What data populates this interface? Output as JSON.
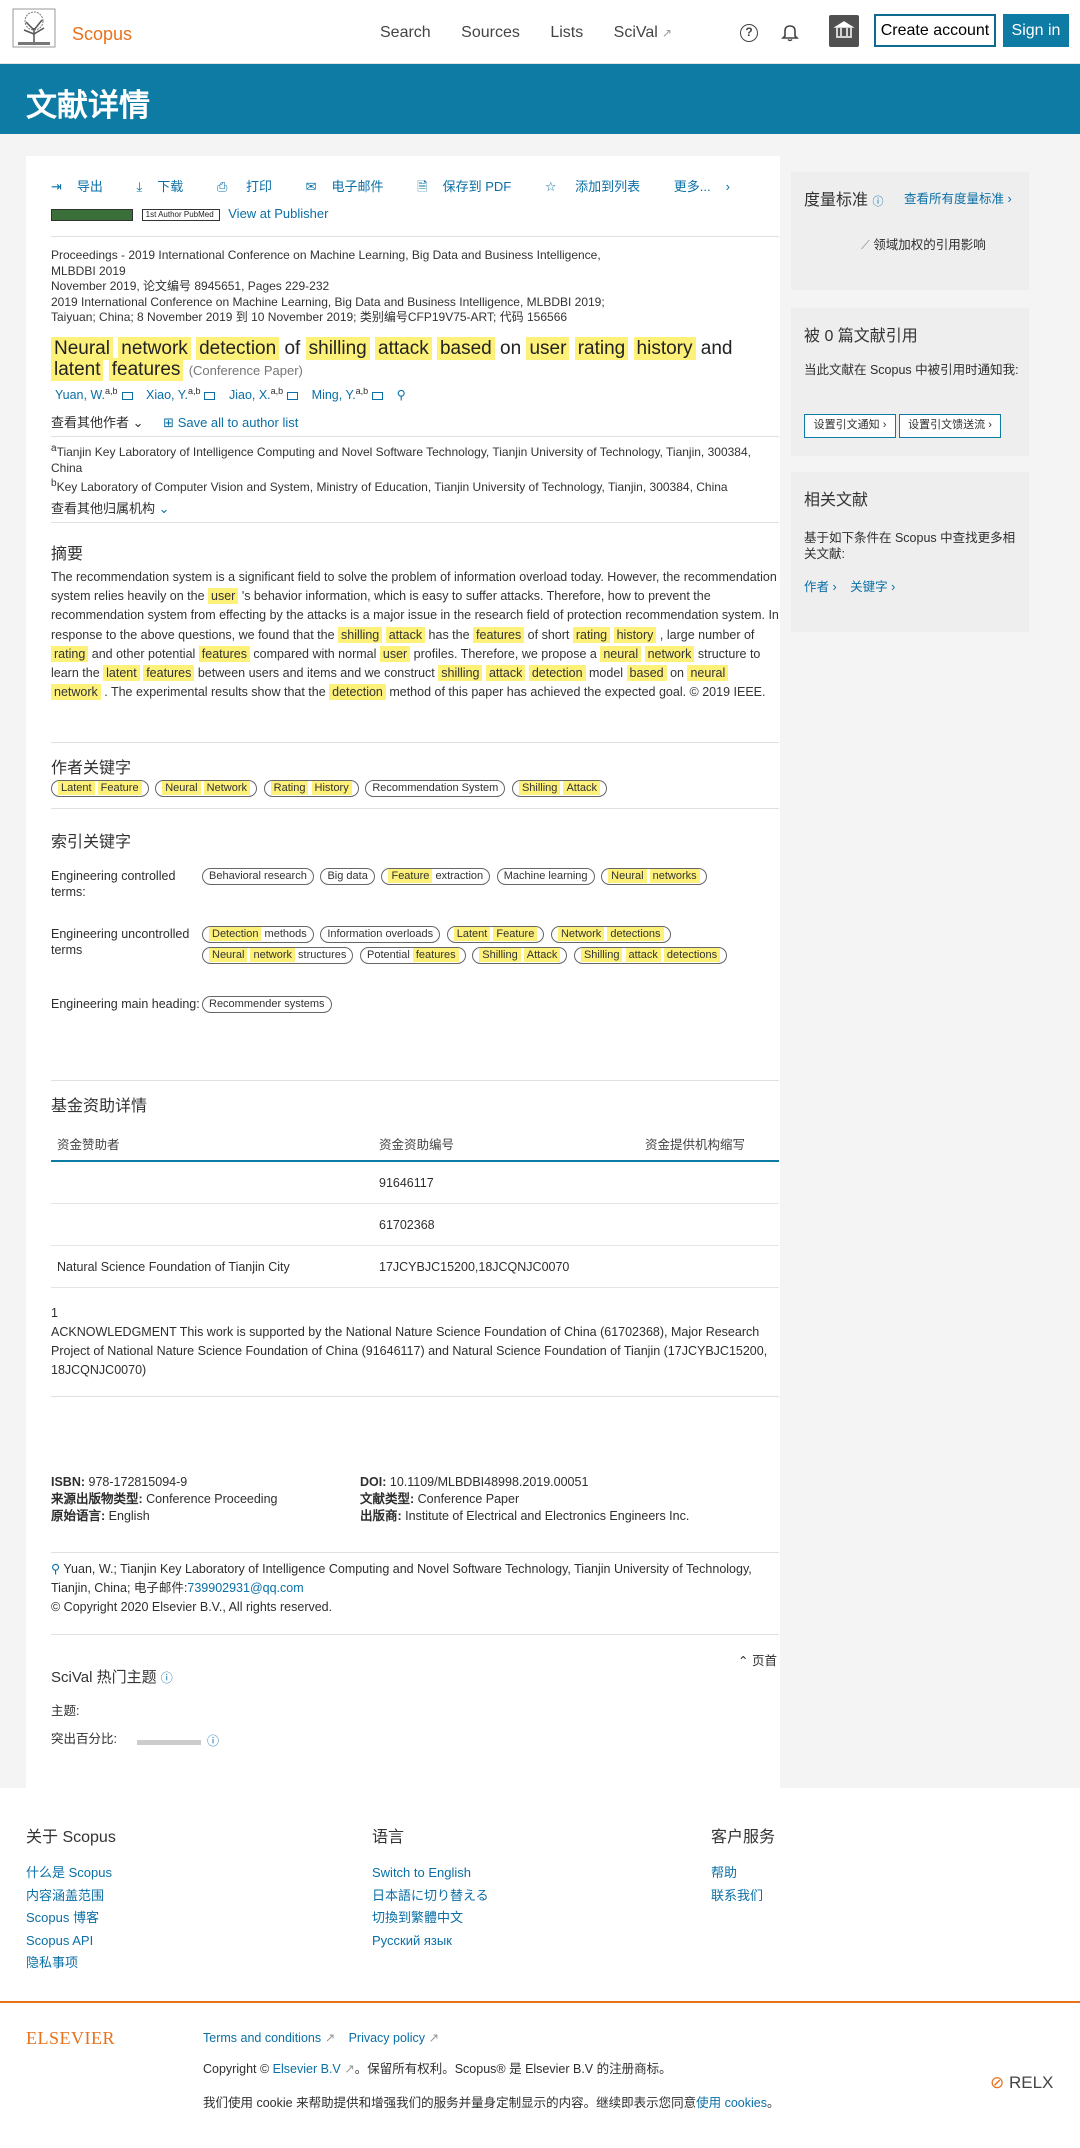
{
  "header": {
    "brand": "Scopus",
    "nav": [
      "Search",
      "Sources",
      "Lists",
      "SciVal"
    ],
    "nav_ext": "↗",
    "create_account": "Create account",
    "sign_in": "Sign in",
    "help": "?"
  },
  "title": "文献详情",
  "toolbar": [
    "导出",
    "下载",
    "打印",
    "电子邮件",
    "保存到 PDF",
    "添加到列表",
    "更多..."
  ],
  "badges": [
    "1st Author PubMed"
  ],
  "view_publisher": "View at Publisher",
  "source_lines": [
    "Proceedings - 2019 International Conference on Machine Learning, Big Data and Business Intelligence,",
    "MLBDBI 2019",
    "November 2019, 论文编号 8945651, Pages 229-232",
    "2019 International Conference on Machine Learning, Big Data and Business Intelligence, MLBDBI 2019;",
    "Taiyuan; China; 8 November 2019 到 10 November 2019; 类别编号CFP19V75-ART; 代码 156566"
  ],
  "doc_title": {
    "line1": [
      "Neural",
      "network",
      "detection",
      "of",
      "shilling",
      "attack",
      "based",
      "on",
      "user",
      "rating",
      "history",
      "and"
    ],
    "line2": [
      "latent",
      "features"
    ],
    "type": "(Conference Paper)"
  },
  "authors": [
    {
      "name": "Yuan, W.",
      "sup": "a,b"
    },
    {
      "name": "Xiao, Y.",
      "sup": "a,b"
    },
    {
      "name": "Jiao, X.",
      "sup": "a,b"
    },
    {
      "name": "Ming, Y.",
      "sup": "a,b"
    }
  ],
  "more_authors": "查看其他作者",
  "save_authors": "Save all to author list",
  "affiliations": [
    {
      "sup": "a",
      "text": "Tianjin Key Laboratory of Intelligence Computing and Novel Software Technology, Tianjin University of Technology, Tianjin, 300384, China"
    },
    {
      "sup": "b",
      "text": "Key Laboratory of Computer Vision and System, Ministry of Education, Tianjin University of Technology, Tianjin, 300384, China"
    }
  ],
  "more_affil": "查看其他归属机构",
  "abstract_heading": "摘要",
  "abstract": "The recommendation system is a significant field to solve the problem of information overload today. However, the recommendation system relies heavily on the user 's behavior information, which is easy to suffer attacks. Therefore, how to prevent the recommendation system from effecting by the attacks is a major issue in the research field of protection recommendation system. In response to the above questions, we found that the shilling attack has the features of short rating history , large number of rating and other potential features compared with normal user profiles. Therefore, we propose a neural network structure to learn the latent features between users and items and we construct shilling attack detection model based on neural network . The experimental results show that the detection method of this paper has achieved the expected goal. © 2019 IEEE.",
  "author_kw_heading": "作者关键字",
  "author_keywords": [
    "Latent Feature",
    "Neural Network",
    "Rating History",
    "Recommendation System",
    "Shilling Attack"
  ],
  "index_kw_heading": "索引关键字",
  "index_kw": [
    {
      "label": "Engineering controlled terms:",
      "tags": [
        "Behavioral research",
        "Big data",
        "Feature extraction",
        "Machine learning",
        "Neural networks"
      ]
    },
    {
      "label": "Engineering uncontrolled terms",
      "tags": [
        "Detection methods",
        "Information overloads",
        "Latent Feature",
        "Network detections",
        "Neural network structures",
        "Potential features",
        "Shilling Attack",
        "Shilling attack detections"
      ]
    },
    {
      "label": "Engineering main heading:",
      "tags": [
        "Recommender systems"
      ]
    }
  ],
  "funding_heading": "基金资助详情",
  "funding_cols": [
    "资金赞助者",
    "资金资助编号",
    "资金提供机构缩写"
  ],
  "funding_rows": [
    [
      "",
      "91646117",
      ""
    ],
    [
      "",
      "61702368",
      ""
    ],
    [
      "Natural Science Foundation of Tianjin City",
      "17JCYBJC15200,18JCQNJC0070",
      ""
    ]
  ],
  "ack_number": "1",
  "ack": "ACKNOWLEDGMENT This work is supported by the National Nature Science Foundation of China (61702368), Major Research Project of National Nature Science Foundation of China (91646117) and Natural Science Foundation of Tianjin (17JCYBJC15200, 18JCQNJC0070)",
  "meta": {
    "isbn_label": "ISBN:",
    "isbn": "978-172815094-9",
    "doi_label": "DOI:",
    "doi": "10.1109/MLBDBI48998.2019.00051",
    "srctype_label": "来源出版物类型:",
    "srctype": "Conference Proceeding",
    "doctype_label": "文献类型:",
    "doctype": "Conference Paper",
    "lang_label": "原始语言:",
    "lang": "English",
    "pub_label": "出版商:",
    "pub": "Institute of Electrical and Electronics Engineers Inc."
  },
  "correspondence": "Yuan, W.; Tianjin Key Laboratory of Intelligence Computing and Novel Software Technology, Tianjin University of Technology, Tianjin, China; 电子邮件:",
  "corr_email": "739902931@qq.com",
  "copyright": "© Copyright 2020 Elsevier B.V., All rights reserved.",
  "page_top": "页首",
  "scival": {
    "heading": "SciVal 热门主题",
    "topic": "主题:",
    "prominence": "突出百分比:"
  },
  "side": {
    "metrics_title": "度量标准",
    "metrics_link": "查看所有度量标准",
    "fwci": "领域加权的引用影响",
    "cited_title": "被 0 篇文献引用",
    "cited_text": "当此文献在 Scopus 中被引用时通知我:",
    "alert_btn": "设置引文通知",
    "feed_btn": "设置引文馈送流",
    "related_title": "相关文献",
    "related_text": "基于如下条件在 Scopus 中查找更多相关文献:",
    "related_links": [
      "作者",
      "关键字"
    ]
  },
  "footer": {
    "col1_title": "关于 Scopus",
    "col1": [
      "什么是 Scopus",
      "内容涵盖范围",
      "Scopus 博客",
      "Scopus API",
      "隐私事项"
    ],
    "col2_title": "语言",
    "col2": [
      "Switch to English",
      "日本語に切り替える",
      "切換到繁體中文",
      "Русский язык"
    ],
    "col3_title": "客户服务",
    "col3": [
      "帮助",
      "联系我们"
    ],
    "elsevier": "ELSEVIER",
    "terms": "Terms and conditions",
    "privacy": "Privacy policy",
    "copy_prefix": "Copyright ©",
    "copy_link": "Elsevier B.V",
    "copy_suffix": "。保留所有权利。Scopus® 是 Elsevier B.V 的注册商标。",
    "cookie_text": "我们使用 cookie 来帮助提供和增强我们的服务并量身定制显示的内容。继续即表示您同意",
    "cookie_link": "使用 cookies",
    "relx": "RELX"
  },
  "colors": {
    "brand": "#e9711c",
    "primary": "#0e7ba4",
    "highlight": "#fdf17a"
  }
}
